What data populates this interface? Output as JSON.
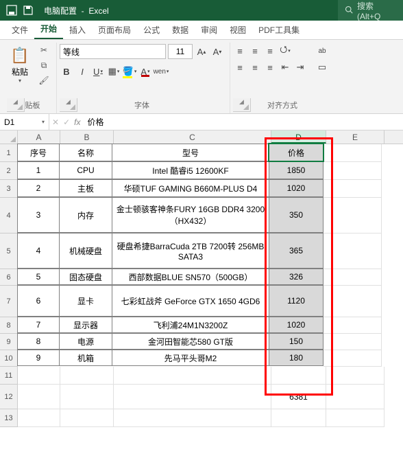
{
  "titlebar": {
    "filename": "电脑配置",
    "appname": "Excel",
    "search_placeholder": "搜索(Alt+Q"
  },
  "tabs": {
    "file": "文件",
    "home": "开始",
    "insert": "插入",
    "layout": "页面布局",
    "formulas": "公式",
    "data": "数据",
    "review": "审阅",
    "view": "视图",
    "pdf": "PDF工具集"
  },
  "ribbon": {
    "clipboard": {
      "paste": "粘贴",
      "label": "剪贴板"
    },
    "font": {
      "name": "等线",
      "size": "11",
      "wen": "wen",
      "label": "字体"
    },
    "align": {
      "label": "对齐方式",
      "wrap_hint": "ab"
    }
  },
  "namebox": "D1",
  "fx_value": "价格",
  "colheads": [
    "A",
    "B",
    "C",
    "D",
    "E"
  ],
  "rows": {
    "header": {
      "a": "序号",
      "b": "名称",
      "c": "型号",
      "d": "价格"
    },
    "data": [
      {
        "a": "1",
        "b": "CPU",
        "c": "Intel 酷睿i5 12600KF",
        "d": "1850"
      },
      {
        "a": "2",
        "b": "主板",
        "c": "华硕TUF GAMING B660M-PLUS D4",
        "d": "1020"
      },
      {
        "a": "3",
        "b": "内存",
        "c": "金士顿骇客神条FURY 16GB DDR4 3200（HX432）",
        "d": "350"
      },
      {
        "a": "4",
        "b": "机械硬盘",
        "c": "硬盘希捷BarraCuda 2TB 7200转 256MB SATA3",
        "d": "365"
      },
      {
        "a": "5",
        "b": "固态硬盘",
        "c": "西部数据BLUE SN570（500GB）",
        "d": "326"
      },
      {
        "a": "6",
        "b": "显卡",
        "c": "七彩虹战斧 GeForce GTX 1650 4GD6",
        "d": "1120"
      },
      {
        "a": "7",
        "b": "显示器",
        "c": "飞利浦24M1N3200Z",
        "d": "1020"
      },
      {
        "a": "8",
        "b": "电源",
        "c": "金河田智能芯580 GT版",
        "d": "150"
      },
      {
        "a": "9",
        "b": "机箱",
        "c": "先马平头哥M2",
        "d": "180"
      }
    ],
    "sum": "6381"
  },
  "chart_data": {
    "type": "table",
    "title": "电脑配置",
    "columns": [
      "序号",
      "名称",
      "型号",
      "价格"
    ],
    "rows": [
      [
        1,
        "CPU",
        "Intel 酷睿i5 12600KF",
        1850
      ],
      [
        2,
        "主板",
        "华硕TUF GAMING B660M-PLUS D4",
        1020
      ],
      [
        3,
        "内存",
        "金士顿骇客神条FURY 16GB DDR4 3200（HX432）",
        350
      ],
      [
        4,
        "机械硬盘",
        "硬盘希捷BarraCuda 2TB 7200转 256MB SATA3",
        365
      ],
      [
        5,
        "固态硬盘",
        "西部数据BLUE SN570（500GB）",
        326
      ],
      [
        6,
        "显卡",
        "七彩虹战斧 GeForce GTX 1650 4GD6",
        1120
      ],
      [
        7,
        "显示器",
        "飞利浦24M1N3200Z",
        1020
      ],
      [
        8,
        "电源",
        "金河田智能芯580 GT版",
        150
      ],
      [
        9,
        "机箱",
        "先马平头哥M2",
        180
      ]
    ],
    "total": 6381
  }
}
